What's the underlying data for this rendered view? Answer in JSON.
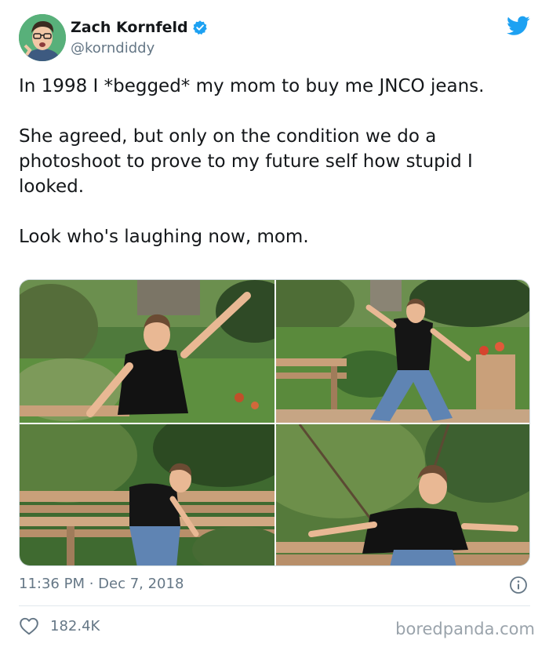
{
  "author": {
    "name": "Zach Kornfeld",
    "handle": "@korndiddy",
    "verified": true
  },
  "tweet": {
    "text": "In 1998 I *begged* my mom to buy me JNCO jeans.\n\nShe agreed, but only on the condition we do a photoshoot to prove to my future self how stupid I looked.\n\nLook who's laughing now, mom."
  },
  "media": {
    "photos": [
      {
        "subject": "boy in black t-shirt raising arm in garden"
      },
      {
        "subject": "boy in wide jeans lunging near bench and planter"
      },
      {
        "subject": "boy leaning on wooden bench"
      },
      {
        "subject": "boy stretched across wooden bench"
      }
    ]
  },
  "meta": {
    "timestamp": "11:36 PM · Dec 7, 2018",
    "likes": "182.4K"
  },
  "watermark": "boredpanda.com",
  "colors": {
    "twitter_blue": "#1da1f2",
    "secondary_text": "#657786"
  },
  "icons": [
    "verified-badge-icon",
    "twitter-bird-icon",
    "info-icon",
    "heart-icon"
  ]
}
